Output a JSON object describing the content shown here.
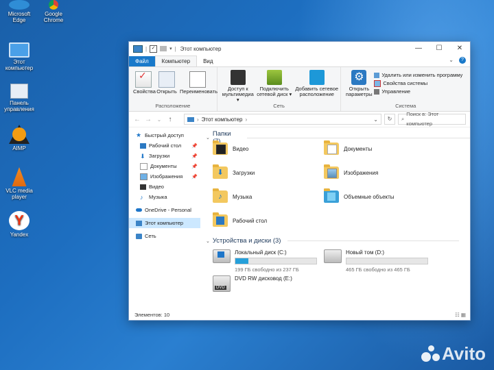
{
  "desktop": {
    "icons": [
      {
        "label": "Microsoft\nEdge"
      },
      {
        "label": "Google\nChrome"
      },
      {
        "label": "Этот\nкомпьютер"
      },
      {
        "label": "Панель\nуправления"
      },
      {
        "label": "AIMP"
      },
      {
        "label": "VLC media\nplayer"
      },
      {
        "label": "Yandex"
      }
    ]
  },
  "window": {
    "title": "Этот компьютер",
    "controls": {
      "minimize": "—",
      "maximize": "☐",
      "close": "✕"
    },
    "tabs": [
      {
        "label": "Файл"
      },
      {
        "label": "Компьютер"
      },
      {
        "label": "Вид"
      }
    ],
    "ribbon": {
      "location": {
        "label": "Расположение",
        "buttons": [
          {
            "label": "Свойства"
          },
          {
            "label": "Открыть"
          },
          {
            "label": "Переименовать"
          }
        ]
      },
      "network": {
        "label": "Сеть",
        "buttons": [
          {
            "label": "Доступ к мультимедиа ▾"
          },
          {
            "label": "Подключить сетевой диск ▾"
          },
          {
            "label": "Добавить сетевое расположение"
          }
        ]
      },
      "system": {
        "label": "Система",
        "open_params": "Открыть параметры",
        "items": [
          {
            "label": "Удалить или изменить программу"
          },
          {
            "label": "Свойства системы"
          },
          {
            "label": "Управление"
          }
        ]
      }
    },
    "address": {
      "back": "←",
      "forward": "→",
      "down": "⌄",
      "up": "↑",
      "path": "Этот компьютер",
      "sep": "›",
      "dropdown": "⌄",
      "refresh": "↻",
      "search_placeholder": "Поиск в: Этот компьютер"
    },
    "nav": [
      {
        "label": "Быстрый доступ"
      },
      {
        "label": "Рабочий стол"
      },
      {
        "label": "Загрузки"
      },
      {
        "label": "Документы"
      },
      {
        "label": "Изображения"
      },
      {
        "label": "Видео"
      },
      {
        "label": "Музыка"
      },
      {
        "label": "OneDrive - Personal"
      },
      {
        "label": "Этот компьютер"
      },
      {
        "label": "Сеть"
      }
    ],
    "folders_header": "Папки (7)",
    "folders": [
      {
        "label": "Видео"
      },
      {
        "label": "Документы"
      },
      {
        "label": "Загрузки"
      },
      {
        "label": "Изображения"
      },
      {
        "label": "Музыка"
      },
      {
        "label": "Объемные объекты"
      },
      {
        "label": "Рабочий стол"
      }
    ],
    "drives_header": "Устройства и диски (3)",
    "drives": [
      {
        "label": "Локальный диск (C:)",
        "free": "199 ГБ свободно из 237 ГБ",
        "used_fraction": 0.16
      },
      {
        "label": "Новый том (D:)",
        "free": "465 ГБ свободно из 465 ГБ",
        "used_fraction": 0.0
      },
      {
        "label": "DVD RW дисковод (E:)",
        "badge": "DVD"
      }
    ],
    "status": "Элементов: 10",
    "view_icons": "☷ ▦"
  },
  "watermark": "Avito",
  "colors": {
    "accent": "#1979ca",
    "selection": "#cce8ff",
    "drive_fill": "#26a0da",
    "folder": "#f3c85f"
  }
}
